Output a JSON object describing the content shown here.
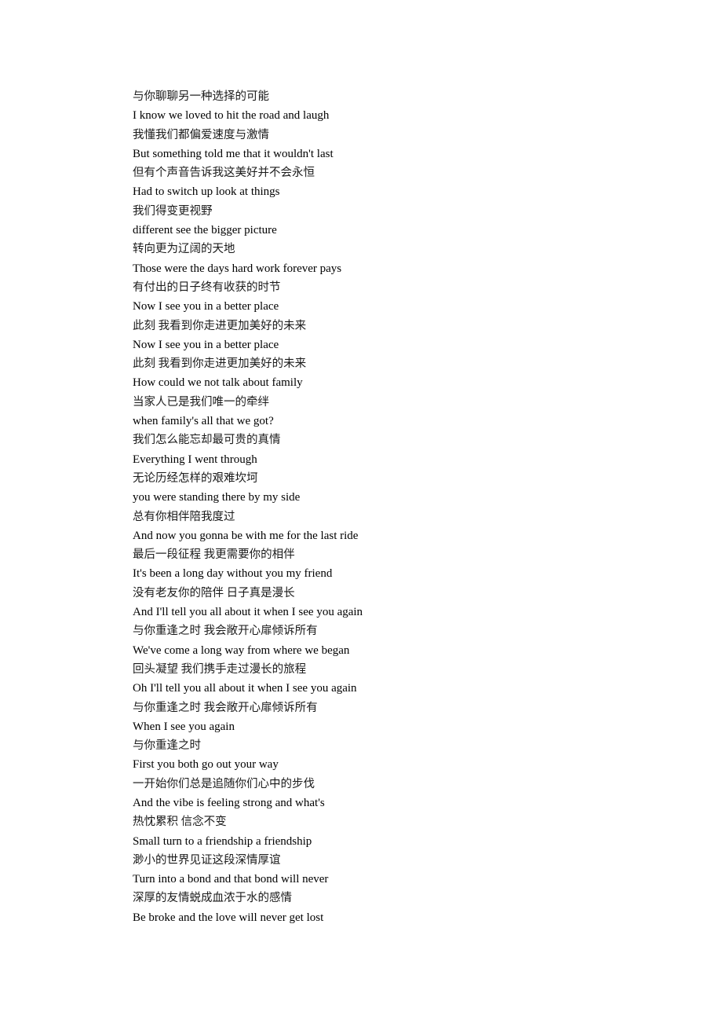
{
  "document": {
    "type": "lyrics-sheet",
    "background_color": "#ffffff",
    "text_color": "#000000",
    "lines": [
      {
        "text": "与你聊聊另一种选择的可能",
        "lang": "zh"
      },
      {
        "text": "I know we loved to hit the road and laugh",
        "lang": "en"
      },
      {
        "text": "我懂我们都偏爱速度与激情",
        "lang": "zh"
      },
      {
        "text": "But something told me that it wouldn't last",
        "lang": "en"
      },
      {
        "text": "但有个声音告诉我这美好并不会永恒",
        "lang": "zh"
      },
      {
        "text": "Had to switch up look at things",
        "lang": "en"
      },
      {
        "text": "我们得变更视野",
        "lang": "zh"
      },
      {
        "text": "different see the bigger picture",
        "lang": "en"
      },
      {
        "text": "转向更为辽阔的天地",
        "lang": "zh"
      },
      {
        "text": "Those were the days hard work forever pays",
        "lang": "en"
      },
      {
        "text": "有付出的日子终有收获的时节",
        "lang": "zh"
      },
      {
        "text": "Now I see you in a better place",
        "lang": "en"
      },
      {
        "text": "此刻 我看到你走进更加美好的未来",
        "lang": "zh"
      },
      {
        "text": "Now I see you in a better place",
        "lang": "en"
      },
      {
        "text": "此刻 我看到你走进更加美好的未来",
        "lang": "zh"
      },
      {
        "text": "How could we not talk about family",
        "lang": "en"
      },
      {
        "text": "当家人已是我们唯一的牵绊",
        "lang": "zh"
      },
      {
        "text": "when family's all that we got?",
        "lang": "en"
      },
      {
        "text": "我们怎么能忘却最可贵的真情",
        "lang": "zh"
      },
      {
        "text": "Everything I went through",
        "lang": "en"
      },
      {
        "text": "无论历经怎样的艰难坎坷",
        "lang": "zh"
      },
      {
        "text": "you were standing there by my side",
        "lang": "en"
      },
      {
        "text": "总有你相伴陪我度过",
        "lang": "zh"
      },
      {
        "text": "And now you gonna be with me for the last ride",
        "lang": "en"
      },
      {
        "text": "最后一段征程 我更需要你的相伴",
        "lang": "zh"
      },
      {
        "text": "It's been a long day without you my friend",
        "lang": "en"
      },
      {
        "text": "没有老友你的陪伴 日子真是漫长",
        "lang": "zh"
      },
      {
        "text": "And I'll tell you all about it when I see you again",
        "lang": "en"
      },
      {
        "text": "与你重逢之时 我会敞开心扉倾诉所有",
        "lang": "zh"
      },
      {
        "text": "We've come a long way from where we began",
        "lang": "en"
      },
      {
        "text": "回头凝望 我们携手走过漫长的旅程",
        "lang": "zh"
      },
      {
        "text": "Oh I'll tell you all about it when I see you again",
        "lang": "en"
      },
      {
        "text": "与你重逢之时 我会敞开心扉倾诉所有",
        "lang": "zh"
      },
      {
        "text": "When I see you again",
        "lang": "en"
      },
      {
        "text": "与你重逢之时",
        "lang": "zh"
      },
      {
        "text": "First you both go out your way",
        "lang": "en"
      },
      {
        "text": "一开始你们总是追随你们心中的步伐",
        "lang": "zh"
      },
      {
        "text": "And the vibe is feeling strong and what's",
        "lang": "en"
      },
      {
        "text": "热忱累积 信念不变",
        "lang": "zh"
      },
      {
        "text": "Small turn to a friendship a friendship",
        "lang": "en"
      },
      {
        "text": "渺小的世界见证这段深情厚谊",
        "lang": "zh"
      },
      {
        "text": "Turn into a bond and that bond will never",
        "lang": "en"
      },
      {
        "text": "深厚的友情蜕成血浓于水的感情",
        "lang": "zh"
      },
      {
        "text": "Be broke and the love will never get lost",
        "lang": "en"
      }
    ]
  }
}
